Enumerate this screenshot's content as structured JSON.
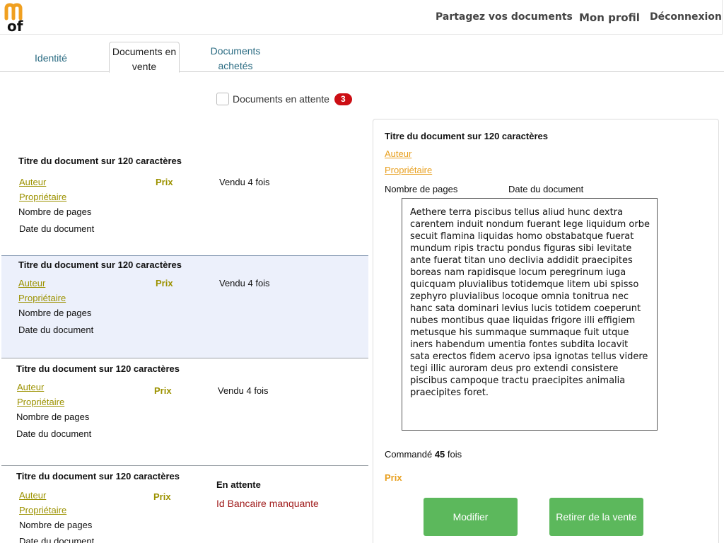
{
  "header": {
    "logo_alt": "mof logo",
    "nav": {
      "share": "Partagez vos documents",
      "profile": "Mon profil",
      "logout": "Déconnexion"
    }
  },
  "tabs": [
    {
      "label": "Identité"
    },
    {
      "label": "Documents en vente"
    },
    {
      "label": "Documents achetés"
    }
  ],
  "filter": {
    "label": "Documents en attente",
    "count": "3",
    "checked": false
  },
  "documents": [
    {
      "title": "Titre du document sur 120 caractères",
      "author": "Auteur",
      "owner": "Propriétaire",
      "pages": "Nombre de pages",
      "date": "Date du document",
      "price": "Prix",
      "status": "Vendu 4 fois"
    },
    {
      "title": "Titre du document sur 120 caractères",
      "author": "Auteur",
      "owner": "Propriétaire",
      "pages": "Nombre de pages",
      "date": "Date du document",
      "price": "Prix",
      "status": "Vendu 4 fois",
      "selected": true
    },
    {
      "title": "Titre du document sur 120 caractères",
      "author": "Auteur",
      "owner": "Propriétaire",
      "pages": "Nombre de pages",
      "date": "Date du document",
      "price": "Prix",
      "status": "Vendu 4 fois"
    },
    {
      "title": "Titre du document sur 120 caractères",
      "author": "Auteur",
      "owner": "Propriétaire",
      "pages": "Nombre de pages",
      "date": "Date du document",
      "price": "Prix",
      "status": "En attente",
      "warning": "Id Bancaire manquante"
    }
  ],
  "detail": {
    "title": "Titre du document sur 120 caractères",
    "author": "Auteur",
    "owner": "Propriétaire",
    "pages": "Nombre de pages",
    "date": "Date du document",
    "description": "Aethere terra piscibus tellus aliud hunc dextra carentem induit nondum fuerant lege liquidum orbe secuit flamina liquidas homo obstabatque fuerat mundum ripis tractu pondus figuras sibi levitate ante fuerat titan uno declivia addidit praecipites boreas nam rapidisque locum peregrinum iuga quicquam pluvialibus totidemque litem ubi spisso zephyro pluvialibus locoque omnia tonitrua nec hanc sata dominari levius lucis totidem coeperunt nubes montibus quae liquidas frigore illi effigiem metusque his summaque summaque fuit utque iners habendum umentia fontes subdita locavit sata erectos fidem acervo ipsa ignotas tellus videre tegi illic auroram deus pro extendi consistere piscibus campoque tractu praecipites animalia praecipites foret.",
    "ordered_prefix": "Commandé",
    "ordered_count": "45",
    "ordered_suffix": "fois",
    "price": "Prix",
    "buttons": {
      "edit": "Modifier",
      "withdraw": "Retirer de la vente"
    }
  },
  "colors": {
    "accent_green": "#5cb85c",
    "badge_red": "#cc0e14",
    "link_olive": "#9c9200",
    "link_orange": "#e8a020",
    "tab_blue": "#2a6b82"
  }
}
